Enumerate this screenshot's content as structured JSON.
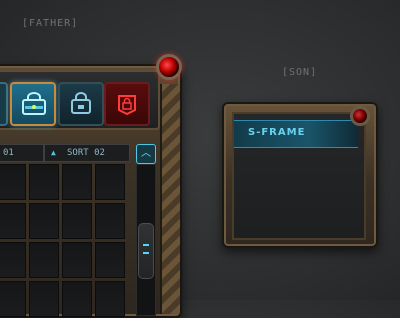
{
  "labels": {
    "father": "[FATHER]",
    "son": "[SON]"
  },
  "father": {
    "tabs": [
      {
        "icon": "bag-icon",
        "state": "partial"
      },
      {
        "icon": "bag-icon",
        "state": "selected"
      },
      {
        "icon": "bag-lock-icon",
        "state": "normal"
      },
      {
        "icon": "lock-icon",
        "state": "locked"
      }
    ],
    "sort_bar": {
      "first_label": "01",
      "second_label": "SORT 02"
    },
    "grid": {
      "columns": 4,
      "rows": 4
    }
  },
  "son": {
    "title": "S-FRAME"
  },
  "colors": {
    "accent": "#4fc7e6",
    "danger": "#c21f1f",
    "frame": "#5b4a34"
  }
}
